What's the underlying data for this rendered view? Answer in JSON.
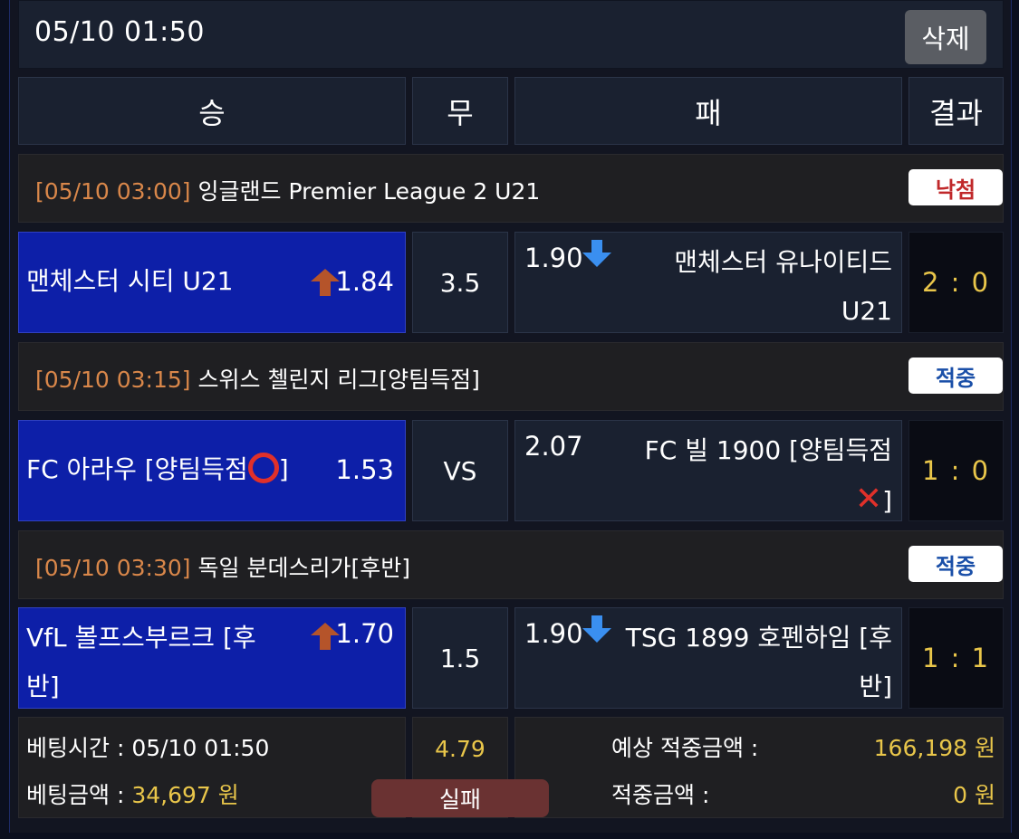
{
  "topbar": {
    "datetime": "05/10 01:50",
    "delete_label": "삭제"
  },
  "header": {
    "win": "승",
    "draw": "무",
    "lose": "패",
    "result": "결과"
  },
  "games": [
    {
      "time": "[05/10 03:00]",
      "league": "잉글랜드 Premier League 2 U21",
      "status": "낙첨",
      "status_color": "#c0282a",
      "home_team": "맨체스터 시티 U21",
      "home_odds": "1.84",
      "home_arrow": "up-arrow-icon",
      "draw": "3.5",
      "away_odds": "1.90",
      "away_arrow": "down-arrow-icon",
      "away_team": "맨체스터 유나이티드 U21",
      "score": "2 : 0"
    },
    {
      "time": "[05/10 03:15]",
      "league": "스위스 첼린지 리그[양팀득점]",
      "status": "적중",
      "status_color": "#1a4fa8",
      "home_team": "FC 아라우 [양팀득점",
      "home_team_suffix": "]",
      "home_odds": "1.53",
      "draw": "VS",
      "away_odds": "2.07",
      "away_team": "FC 빌 1900 [양팀득점",
      "away_team_suffix": "]",
      "score": "1 : 0"
    },
    {
      "time": "[05/10 03:30]",
      "league": "독일 분데스리가[후반]",
      "status": "적중",
      "status_color": "#1a4fa8",
      "home_team_line1": "VfL 볼프스부르크 [후",
      "home_team_line2": "반]",
      "home_odds": "1.70",
      "home_arrow": "up-arrow-icon",
      "draw": "1.5",
      "away_odds": "1.90",
      "away_arrow": "down-arrow-icon",
      "away_team": "TSG 1899 호펜하임 [후반]",
      "score": "1 : 1"
    }
  ],
  "footer": {
    "bet_time_label": "베팅시간 : 05/10 01:50",
    "bet_amount_label": "베팅금액 : ",
    "bet_amount": "34,697 원",
    "total_odds": "4.79",
    "result_label": "실패",
    "expected_label": "예상 적중금액 :",
    "expected_amount": "166,198 원",
    "win_amount_label": "적중금액 :",
    "win_amount": "0 원"
  }
}
